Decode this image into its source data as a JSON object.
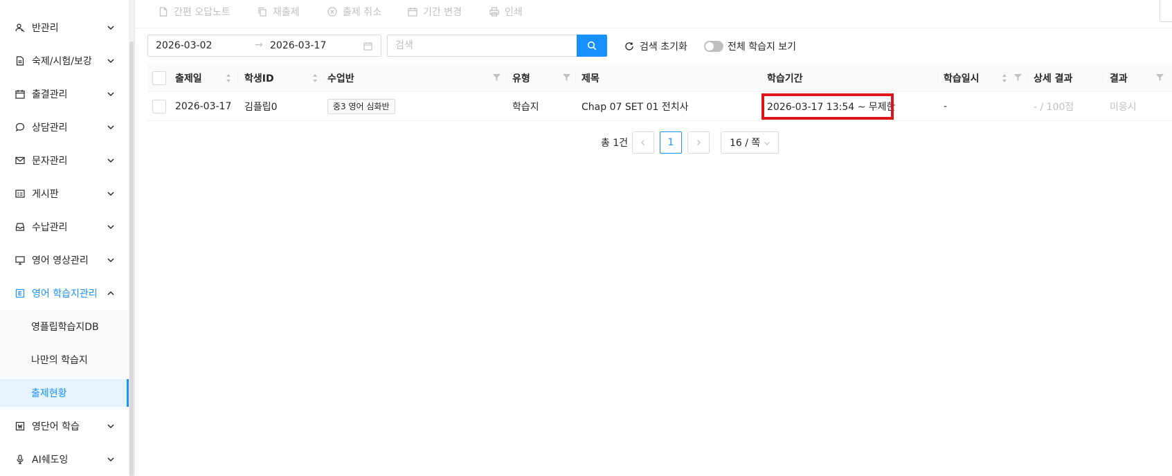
{
  "sidebar": {
    "items": [
      {
        "label": "반관리",
        "icon": "class-icon"
      },
      {
        "label": "숙제/시험/보강",
        "icon": "document-icon"
      },
      {
        "label": "출결관리",
        "icon": "calendar-icon"
      },
      {
        "label": "상담관리",
        "icon": "chat-icon"
      },
      {
        "label": "문자관리",
        "icon": "mail-icon"
      },
      {
        "label": "게시판",
        "icon": "board-icon"
      },
      {
        "label": "수납관리",
        "icon": "inbox-icon"
      },
      {
        "label": "영어 영상관리",
        "icon": "monitor-icon"
      },
      {
        "label": "영어 학습지관리",
        "icon": "worksheet-icon"
      },
      {
        "label": "영단어 학습",
        "icon": "vocabulary-icon"
      },
      {
        "label": "AI쉐도잉",
        "icon": "microphone-icon"
      }
    ],
    "subitems": [
      {
        "label": "영플립학습지DB"
      },
      {
        "label": "나만의 학습지"
      },
      {
        "label": "출제현황"
      }
    ]
  },
  "toolbar": {
    "note_label": "간편 오답노트",
    "reissue_label": "재출제",
    "cancel_label": "출제 취소",
    "period_label": "기간 변경",
    "print_label": "인쇄"
  },
  "filter": {
    "start_date": "2026-03-02",
    "end_date": "2026-03-17",
    "search_placeholder": "검색",
    "reset_label": "검색 초기화",
    "toggle_label": "전체 학습지 보기",
    "toggle_on": false
  },
  "table": {
    "columns": [
      "출제일",
      "학생ID",
      "수업반",
      "유형",
      "제목",
      "학습기간",
      "학습일시",
      "상세 결과",
      "결과"
    ],
    "rows": [
      {
        "date": "2026-03-17",
        "student": "김플립0",
        "class": "중3 영어 심화반",
        "type": "학습지",
        "title": "Chap 07 SET 01 전치사",
        "period": "2026-03-17 13:54 ~ 무제한",
        "study_time": "-",
        "detail": "- / 100점",
        "result": "미응시"
      }
    ]
  },
  "pagination": {
    "total": "총 1건",
    "current": "1",
    "page_size": "16 / 쪽"
  },
  "colors": {
    "accent": "#1890ff",
    "highlight": "#e0151b"
  }
}
